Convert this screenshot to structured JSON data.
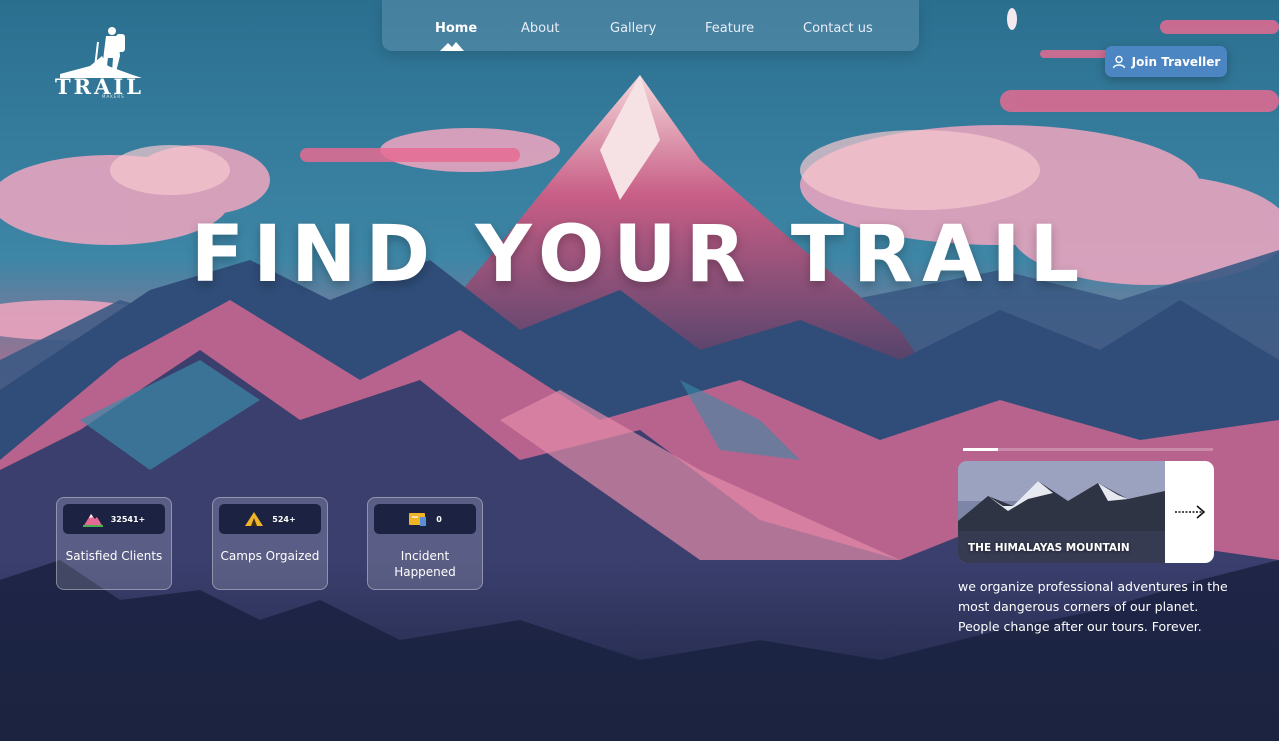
{
  "brand": {
    "name": "TRAIL",
    "tagline": "MAKERS"
  },
  "nav": {
    "items": [
      {
        "label": "Home",
        "active": true
      },
      {
        "label": "About",
        "active": false
      },
      {
        "label": "Gallery",
        "active": false
      },
      {
        "label": "Feature",
        "active": false
      },
      {
        "label": "Contact us",
        "active": false
      }
    ]
  },
  "join_button": {
    "label": "Join Traveller",
    "icon": "user-icon"
  },
  "hero": {
    "title": "FIND YOUR TRAIL"
  },
  "stats": [
    {
      "icon": "mountain-icon",
      "value": "32541+",
      "label": "Satisfied Clients"
    },
    {
      "icon": "tent-icon",
      "value": "524+",
      "label": "Camps Orgaized"
    },
    {
      "icon": "incident-icon",
      "value": "0",
      "label": "Incident Happened"
    }
  ],
  "featured": {
    "caption": "THE HIMALAYAS MOUNTAIN",
    "progress": 0.14,
    "arrow_icon": "arrow-right-icon",
    "description": "we organize professional adventures in the most dangerous corners of our planet. People change after our tours. Forever."
  },
  "colors": {
    "accent": "#4b86c2",
    "dark": "#1c2342",
    "pink": "#e36a92",
    "teal": "#2f7a96"
  }
}
